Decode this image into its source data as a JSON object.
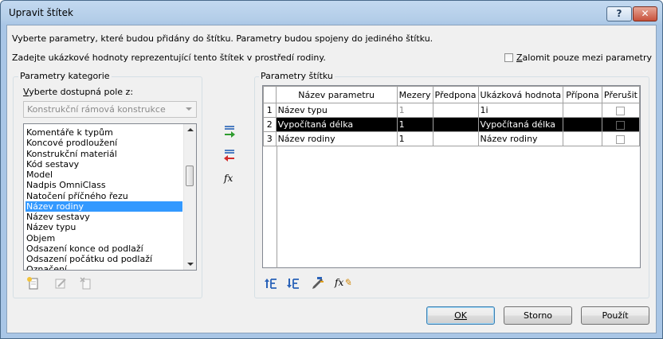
{
  "dialog": {
    "title": "Upravit štítek",
    "help_label": "?",
    "close_label": "✕"
  },
  "intro": {
    "line1": "Vyberte parametry, které budou přidány do štítku. Parametry budou spojeny do jediného štítku.",
    "line2": "Zadejte ukázkové hodnoty reprezentující tento štítek v prostředí rodiny."
  },
  "wrap_option": {
    "label_first": "Z",
    "label_rest": "alomit pouze mezi parametry",
    "checked": false
  },
  "category_panel": {
    "legend": "Parametry kategorie",
    "select_label_first": "V",
    "select_label_rest": "yberte dostupná pole z:",
    "combo_value": "Konstrukční rámová konstrukce",
    "items": [
      "Komentáře k typům",
      "Koncové prodloužení",
      "Konstrukční materiál",
      "Kód sestavy",
      "Model",
      "Nadpis OmniClass",
      "Natočení příčného řezu",
      "Název rodiny",
      "Název sestavy",
      "Název typu",
      "Objem",
      "Odsazení konce od podlaží",
      "Odsazení počátku od podlaží",
      "Označení"
    ],
    "selected_index": 7,
    "tool_icons": [
      "new-parameter-icon",
      "edit-parameter-icon",
      "delete-parameter-icon"
    ]
  },
  "move_buttons": {
    "add_icon": "add-to-label-icon",
    "remove_icon": "remove-from-label-icon",
    "formula_label": "fx"
  },
  "label_panel": {
    "legend": "Parametry štítku",
    "columns": [
      "",
      "Název parametru",
      "Mezery",
      "Předpona",
      "Ukázková hodnota",
      "Přípona",
      "Přerušit"
    ],
    "rows": [
      {
        "num": "1",
        "name": "Název typu",
        "spaces": "1",
        "prefix": "",
        "sample": "1i",
        "suffix": "",
        "break": false
      },
      {
        "num": "2",
        "name": "Vypočítaná délka",
        "spaces": "1",
        "prefix": "",
        "sample": "Vypočítaná délka",
        "suffix": "",
        "break": false
      },
      {
        "num": "3",
        "name": "Název rodiny",
        "spaces": "1",
        "prefix": "",
        "sample": "Název rodiny",
        "suffix": "",
        "break": false
      }
    ],
    "selected_row": 1,
    "tool_icons": [
      "move-up-icon",
      "move-down-icon",
      "edit-units-icon",
      "formula-edit-icon"
    ]
  },
  "footer": {
    "ok_label": "OK",
    "cancel_label": "Storno",
    "apply_label": "Použít"
  },
  "colors": {
    "selection": "#3399ff",
    "row_selected": "#000000",
    "title_bar": "#b3cde8",
    "close_button": "#c7513b"
  }
}
